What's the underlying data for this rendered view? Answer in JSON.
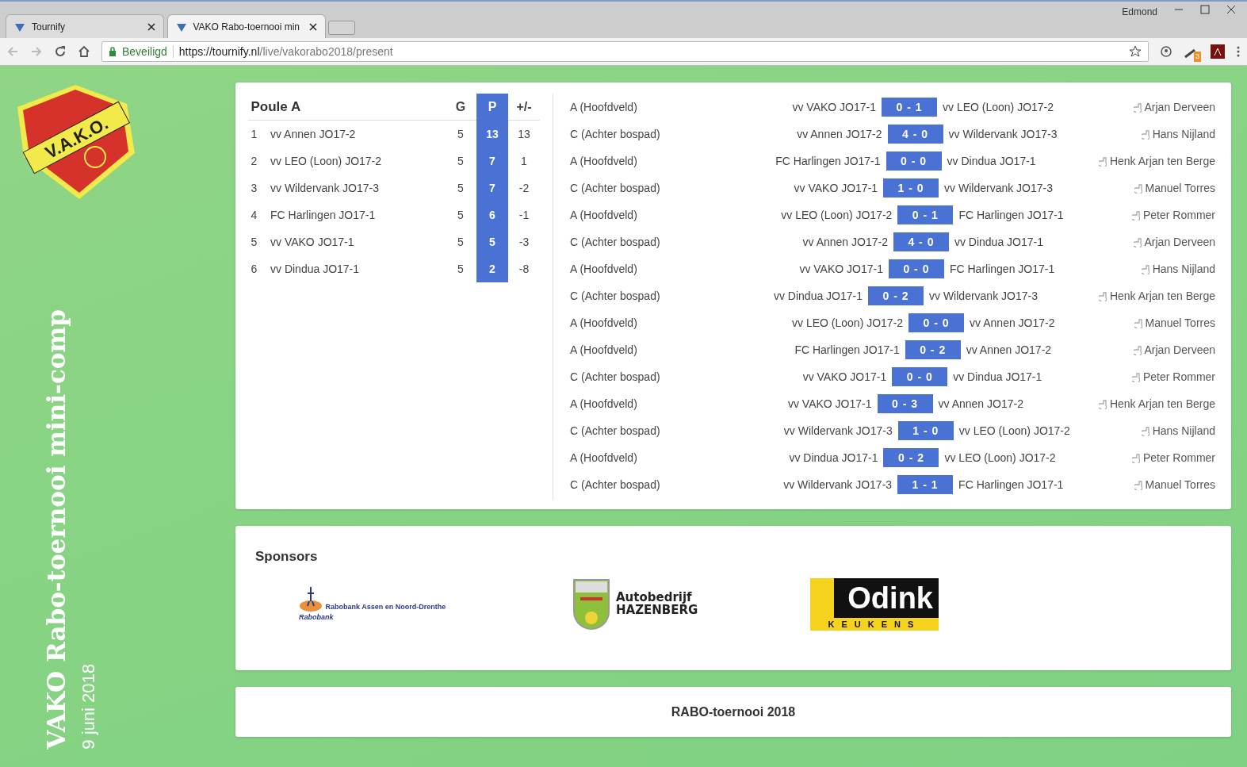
{
  "browser": {
    "tabs": [
      {
        "title": "Tournify",
        "selected": false
      },
      {
        "title": "VAKO Rabo-toernooi min",
        "selected": true
      }
    ],
    "user": "Edmond",
    "secure_label": "Beveiligd",
    "url_host": "https://tournify.nl",
    "url_path": "/live/vakorabo2018/present",
    "extension_badge": "3"
  },
  "sidebar": {
    "crest_text": "V.A.K.O.",
    "title": "VAKO Rabo-toernooi mini-comp",
    "date": "9 juni 2018"
  },
  "standings": {
    "title": "Poule A",
    "columns": [
      "G",
      "P",
      "+/-"
    ],
    "rows": [
      {
        "rank": "1",
        "team": "vv Annen JO17-2",
        "g": "5",
        "p": "13",
        "diff": "13"
      },
      {
        "rank": "2",
        "team": "vv LEO (Loon) JO17-2",
        "g": "5",
        "p": "7",
        "diff": "1"
      },
      {
        "rank": "3",
        "team": "vv Wildervank JO17-3",
        "g": "5",
        "p": "7",
        "diff": "-2"
      },
      {
        "rank": "4",
        "team": "FC Harlingen JO17-1",
        "g": "5",
        "p": "6",
        "diff": "-1"
      },
      {
        "rank": "5",
        "team": "vv VAKO JO17-1",
        "g": "5",
        "p": "5",
        "diff": "-3"
      },
      {
        "rank": "6",
        "team": "vv Dindua JO17-1",
        "g": "5",
        "p": "2",
        "diff": "-8"
      }
    ]
  },
  "matches": [
    {
      "field": "A (Hoofdveld)",
      "home": "vv VAKO JO17-1",
      "score": "0 - 1",
      "away": "vv LEO (Loon) JO17-2",
      "referee": "Arjan Derveen"
    },
    {
      "field": "C (Achter bospad)",
      "home": "vv Annen JO17-2",
      "score": "4 - 0",
      "away": "vv Wildervank JO17-3",
      "referee": "Hans Nijland"
    },
    {
      "field": "A (Hoofdveld)",
      "home": "FC Harlingen JO17-1",
      "score": "0 - 0",
      "away": "vv Dindua JO17-1",
      "referee": "Henk Arjan ten Berge"
    },
    {
      "field": "C (Achter bospad)",
      "home": "vv VAKO JO17-1",
      "score": "1 - 0",
      "away": "vv Wildervank JO17-3",
      "referee": "Manuel Torres"
    },
    {
      "field": "A (Hoofdveld)",
      "home": "vv LEO (Loon) JO17-2",
      "score": "0 - 1",
      "away": "FC Harlingen JO17-1",
      "referee": "Peter Rommer"
    },
    {
      "field": "C (Achter bospad)",
      "home": "vv Annen JO17-2",
      "score": "4 - 0",
      "away": "vv Dindua JO17-1",
      "referee": "Arjan Derveen"
    },
    {
      "field": "A (Hoofdveld)",
      "home": "vv VAKO JO17-1",
      "score": "0 - 0",
      "away": "FC Harlingen JO17-1",
      "referee": "Hans Nijland"
    },
    {
      "field": "C (Achter bospad)",
      "home": "vv Dindua JO17-1",
      "score": "0 - 2",
      "away": "vv Wildervank JO17-3",
      "referee": "Henk Arjan ten Berge"
    },
    {
      "field": "A (Hoofdveld)",
      "home": "vv LEO (Loon) JO17-2",
      "score": "0 - 0",
      "away": "vv Annen JO17-2",
      "referee": "Manuel Torres"
    },
    {
      "field": "A (Hoofdveld)",
      "home": "FC Harlingen JO17-1",
      "score": "0 - 2",
      "away": "vv Annen JO17-2",
      "referee": "Arjan Derveen"
    },
    {
      "field": "C (Achter bospad)",
      "home": "vv VAKO JO17-1",
      "score": "0 - 0",
      "away": "vv Dindua JO17-1",
      "referee": "Peter Rommer"
    },
    {
      "field": "A (Hoofdveld)",
      "home": "vv VAKO JO17-1",
      "score": "0 - 3",
      "away": "vv Annen JO17-2",
      "referee": "Henk Arjan ten Berge"
    },
    {
      "field": "C (Achter bospad)",
      "home": "vv Wildervank JO17-3",
      "score": "1 - 0",
      "away": "vv LEO (Loon) JO17-2",
      "referee": "Hans Nijland"
    },
    {
      "field": "A (Hoofdveld)",
      "home": "vv Dindua JO17-1",
      "score": "0 - 2",
      "away": "vv LEO (Loon) JO17-2",
      "referee": "Peter Rommer"
    },
    {
      "field": "C (Achter bospad)",
      "home": "vv Wildervank JO17-3",
      "score": "1 - 1",
      "away": "FC Harlingen JO17-1",
      "referee": "Manuel Torres"
    }
  ],
  "sponsors": {
    "title": "Sponsors",
    "logos": [
      {
        "kind": "rabobank",
        "lines": [
          "Rabobank Assen en Noord-Drenthe",
          "Rabobank"
        ]
      },
      {
        "kind": "hazenberg",
        "lines": [
          "Autobedrijf",
          "HAZENBERG"
        ]
      },
      {
        "kind": "odink",
        "lines": [
          "Odink",
          "KEUKENS"
        ]
      }
    ]
  },
  "footer": "RABO-toernooi 2018"
}
